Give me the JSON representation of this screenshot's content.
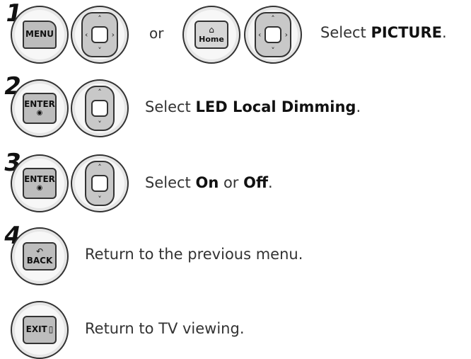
{
  "steps": [
    {
      "number": "1",
      "key1": "MENU",
      "or": "or",
      "key2": "Home",
      "text_prefix": "Select ",
      "text_bold": "PICTURE",
      "text_suffix": "."
    },
    {
      "number": "2",
      "key": "ENTER",
      "key_dot": "◉",
      "text_prefix": "Select ",
      "text_bold": "LED Local Dimming",
      "text_suffix": "."
    },
    {
      "number": "3",
      "key": "ENTER",
      "key_dot": "◉",
      "text_prefix": "Select ",
      "text_bold1": "On",
      "text_mid": " or ",
      "text_bold2": "Off",
      "text_suffix": "."
    },
    {
      "number": "4",
      "key": "BACK",
      "key_symbol": "↶",
      "text": "Return to the previous menu."
    },
    {
      "key": "EXIT",
      "key_symbol": "▯",
      "text": "Return to TV viewing."
    }
  ],
  "icons": [
    "up-arrow-icon",
    "down-arrow-icon",
    "left-arrow-icon",
    "right-arrow-icon",
    "back-arrow-icon",
    "exit-icon",
    "home-icon"
  ]
}
